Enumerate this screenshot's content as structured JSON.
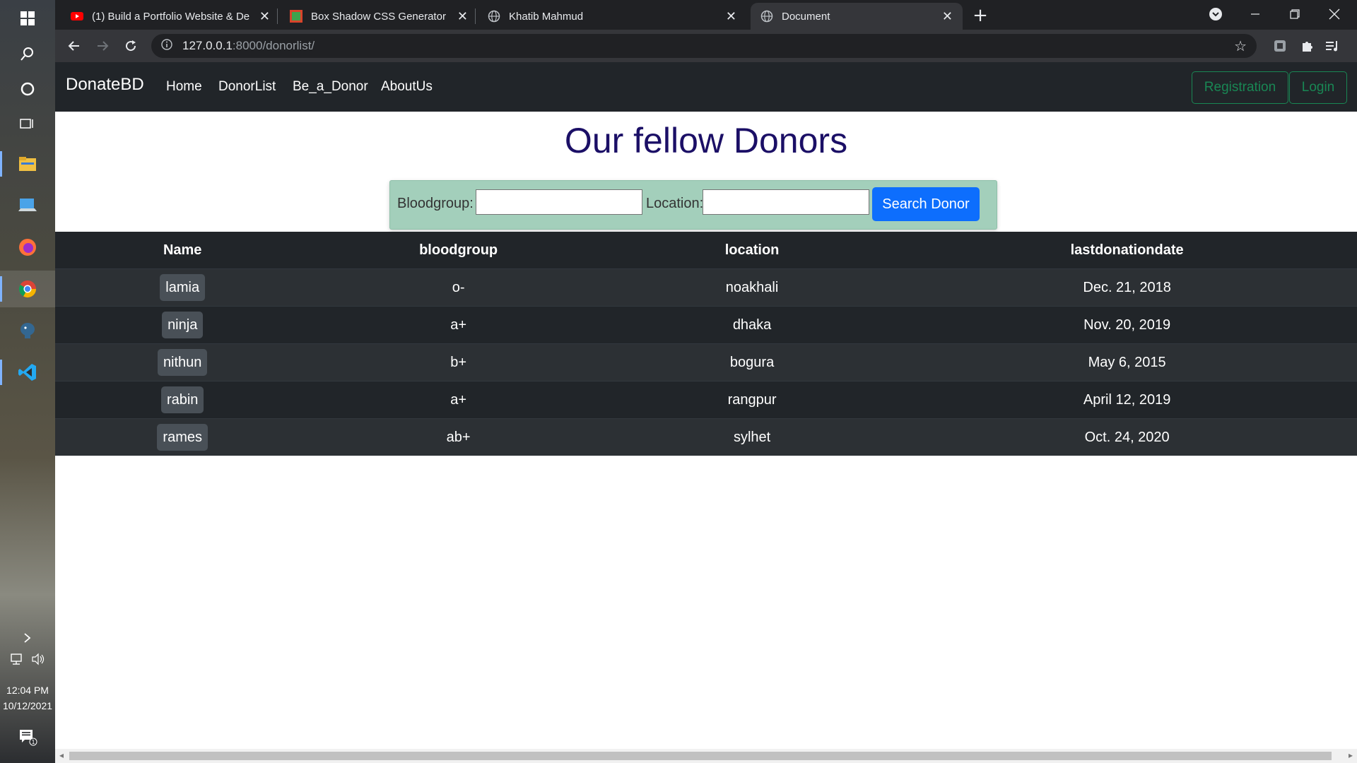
{
  "taskbar": {
    "clock_time": "12:04 PM",
    "clock_date": "10/12/2021",
    "notification_count": "1"
  },
  "browser": {
    "tabs": [
      {
        "title": "(1) Build a Portfolio Website & De",
        "favicon": "youtube-icon"
      },
      {
        "title": "Box Shadow CSS Generator",
        "favicon": "css-generator-icon"
      },
      {
        "title": "Khatib Mahmud",
        "favicon": "globe-icon"
      },
      {
        "title": "Document",
        "favicon": "globe-icon"
      }
    ],
    "address": {
      "host": "127.0.0.1",
      "path": ":8000/donorlist/"
    }
  },
  "navbar": {
    "brand": "DonateBD",
    "links": [
      "Home",
      "DonorList",
      "Be_a_Donor",
      "AboutUs"
    ],
    "registration": "Registration",
    "login": "Login"
  },
  "page": {
    "title": "Our fellow Donors"
  },
  "search": {
    "bloodgroup_label": "Bloodgroup:",
    "bloodgroup_value": "",
    "location_label": "Location:",
    "location_value": "",
    "button": "Search Donor"
  },
  "table": {
    "headers": [
      "Name",
      "bloodgroup",
      "location",
      "lastdonationdate"
    ],
    "rows": [
      [
        "lamia",
        "o-",
        "noakhali",
        "Dec. 21, 2018"
      ],
      [
        "ninja",
        "a+",
        "dhaka",
        "Nov. 20, 2019"
      ],
      [
        "nithun",
        "b+",
        "bogura",
        "May 6, 2015"
      ],
      [
        "rabin",
        "a+",
        "rangpur",
        "April 12, 2019"
      ],
      [
        "rames",
        "ab+",
        "sylhet",
        "Oct. 24, 2020"
      ]
    ]
  },
  "colors": {
    "navbar_bg": "#212529",
    "title": "#1b0f66",
    "search_bg": "#a3cfbb",
    "primary": "#0d6efd",
    "success_outline": "#198754"
  }
}
